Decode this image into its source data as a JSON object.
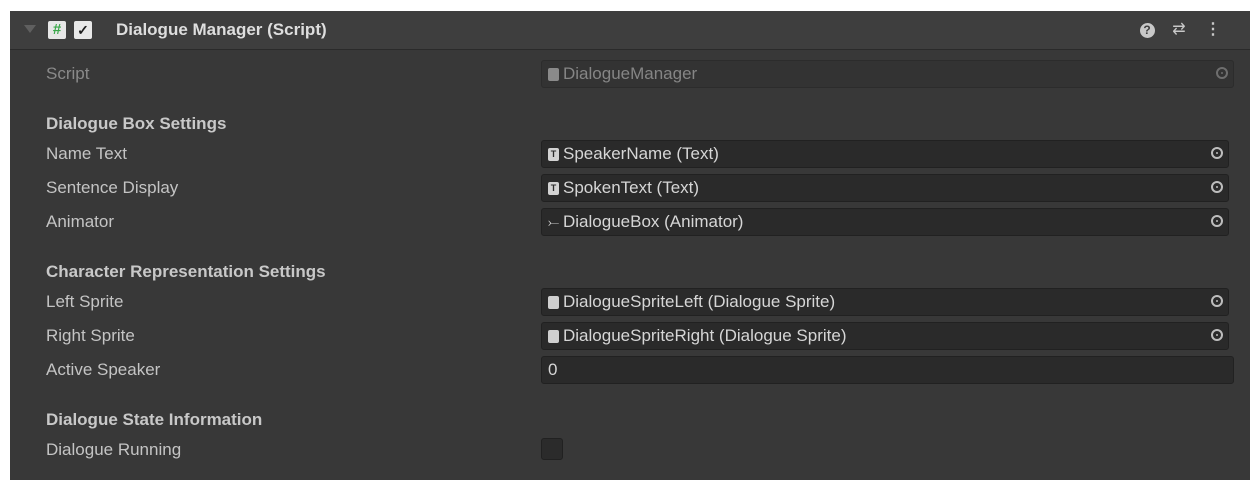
{
  "component": {
    "title": "Dialogue Manager (Script)",
    "enabled": true,
    "hash_glyph": "#",
    "check_glyph": "✓",
    "help_glyph": "?",
    "presets_glyph": "⇄",
    "more_glyph": "⋮"
  },
  "script_row": {
    "label": "Script",
    "value": "DialogueManager"
  },
  "sections": {
    "dialogue_box": {
      "heading": "Dialogue Box Settings",
      "name_text": {
        "label": "Name Text",
        "value": "SpeakerName (Text)",
        "icon": "T"
      },
      "sentence_display": {
        "label": "Sentence Display",
        "value": "SpokenText (Text)",
        "icon": "T"
      },
      "animator": {
        "label": "Animator",
        "value": "DialogueBox (Animator)",
        "icon": "⤚"
      }
    },
    "character": {
      "heading": "Character Representation Settings",
      "left_sprite": {
        "label": "Left Sprite",
        "value": "DialogueSpriteLeft (Dialogue Sprite)"
      },
      "right_sprite": {
        "label": "Right Sprite",
        "value": "DialogueSpriteRight (Dialogue Sprite)"
      },
      "active_speaker": {
        "label": "Active Speaker",
        "value": "0"
      }
    },
    "state": {
      "heading": "Dialogue State Information",
      "dialogue_running": {
        "label": "Dialogue Running",
        "checked": false
      }
    }
  },
  "colors": {
    "panel_bg": "#383838",
    "header_bg": "#3e3e3e",
    "field_bg": "#2a2a2a",
    "script_icon_green": "#3aa84a"
  }
}
